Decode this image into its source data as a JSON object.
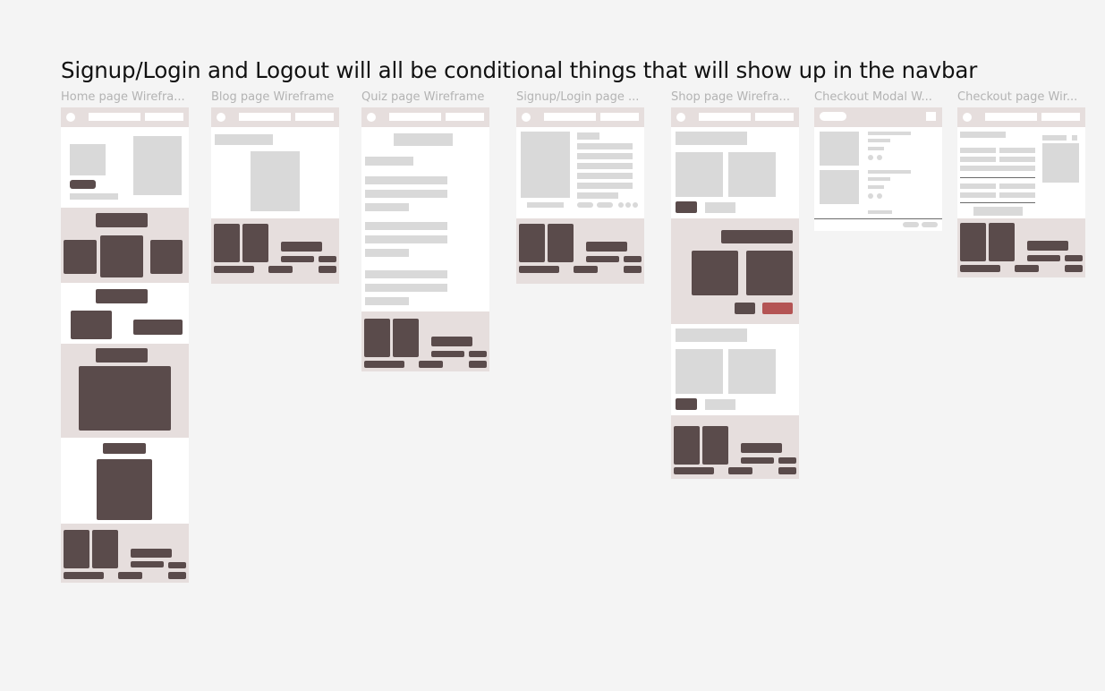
{
  "canvas": {
    "note": "Signup/Login and Logout will all be conditional things that will show up in the navbar"
  },
  "frames": [
    {
      "label": "Home page Wirefra..."
    },
    {
      "label": "Blog page Wireframe"
    },
    {
      "label": "Quiz page Wireframe"
    },
    {
      "label": "Signup/Login page ..."
    },
    {
      "label": "Shop page Wirefra..."
    },
    {
      "label": "Checkout Modal W..."
    },
    {
      "label": "Checkout page Wir..."
    }
  ],
  "colors": {
    "canvas_bg": "#f4f4f4",
    "section_beige": "#e6dedd",
    "block_dark": "#5a4b4b",
    "placeholder_gray": "#d9d9d9",
    "accent_red": "#b45454"
  }
}
